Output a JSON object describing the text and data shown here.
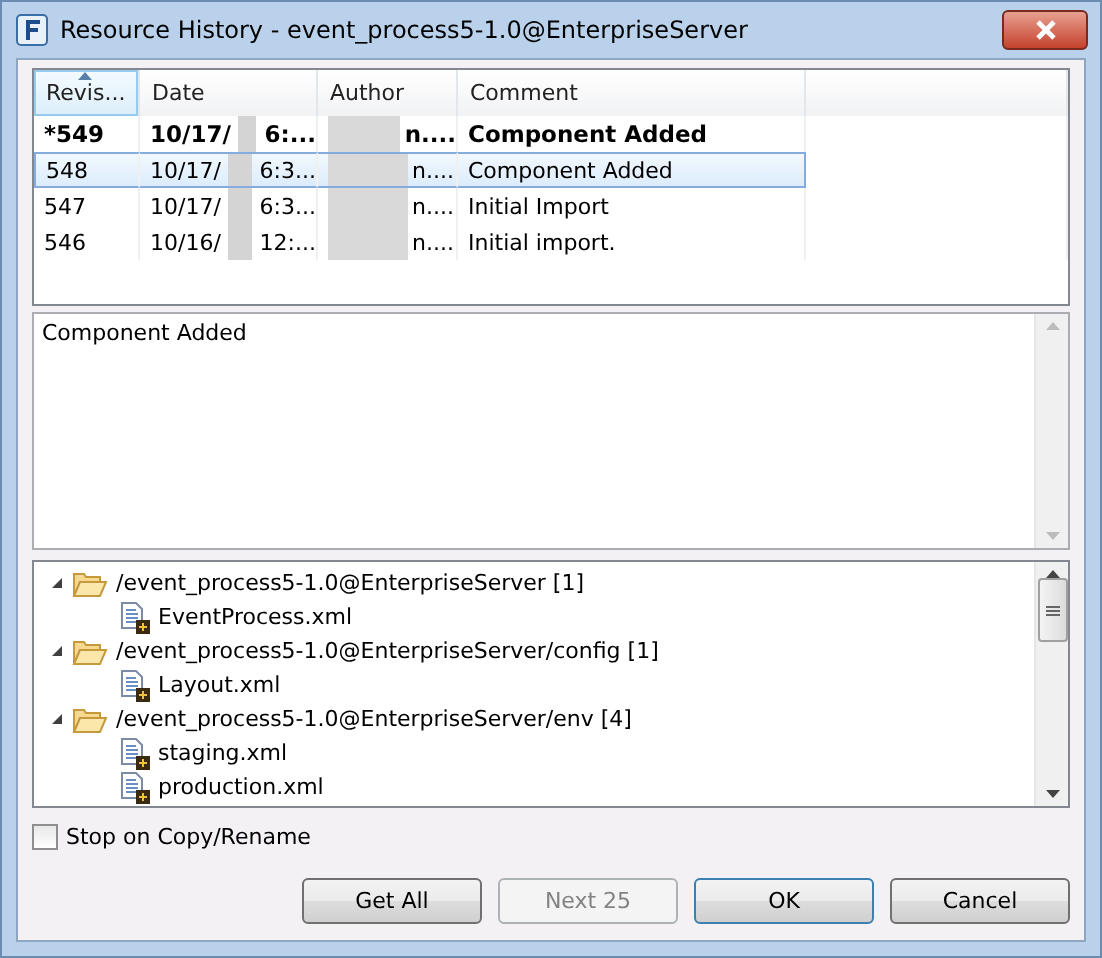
{
  "window": {
    "title": "Resource History - event_process5-1.0@EnterpriseServer"
  },
  "table": {
    "columns": [
      {
        "label": "Revis...",
        "sorted": true
      },
      {
        "label": "Date",
        "sorted": false
      },
      {
        "label": "Author",
        "sorted": false
      },
      {
        "label": "Comment",
        "sorted": false
      }
    ],
    "rows": [
      {
        "revision": "*549",
        "date_start": "10/17/",
        "date_end": "6:...",
        "author": "n....",
        "comment": "Component Added",
        "bold": true,
        "selected": false
      },
      {
        "revision": "548",
        "date_start": "10/17/",
        "date_end": "6:3...",
        "author": "n....",
        "comment": "Component Added",
        "bold": false,
        "selected": true
      },
      {
        "revision": "547",
        "date_start": "10/17/",
        "date_end": "6:3...",
        "author": "n....",
        "comment": "Initial Import",
        "bold": false,
        "selected": false
      },
      {
        "revision": "546",
        "date_start": "10/16/",
        "date_end": "12:...",
        "author": "n....",
        "comment": "Initial import.",
        "bold": false,
        "selected": false
      }
    ]
  },
  "comment_text": "Component Added",
  "tree": [
    {
      "label": "/event_process5-1.0@EnterpriseServer [1]",
      "expanded": true,
      "children": [
        {
          "label": "EventProcess.xml"
        }
      ]
    },
    {
      "label": "/event_process5-1.0@EnterpriseServer/config [1]",
      "expanded": true,
      "children": [
        {
          "label": "Layout.xml"
        }
      ]
    },
    {
      "label": "/event_process5-1.0@EnterpriseServer/env [4]",
      "expanded": true,
      "children": [
        {
          "label": "staging.xml"
        },
        {
          "label": "production.xml"
        }
      ]
    }
  ],
  "checkbox": {
    "label": "Stop on Copy/Rename",
    "checked": false
  },
  "buttons": [
    {
      "label": "Get All",
      "disabled": false,
      "focused": false
    },
    {
      "label": "Next 25",
      "disabled": true,
      "focused": false
    },
    {
      "label": "OK",
      "disabled": false,
      "focused": true
    },
    {
      "label": "Cancel",
      "disabled": false,
      "focused": false
    }
  ]
}
